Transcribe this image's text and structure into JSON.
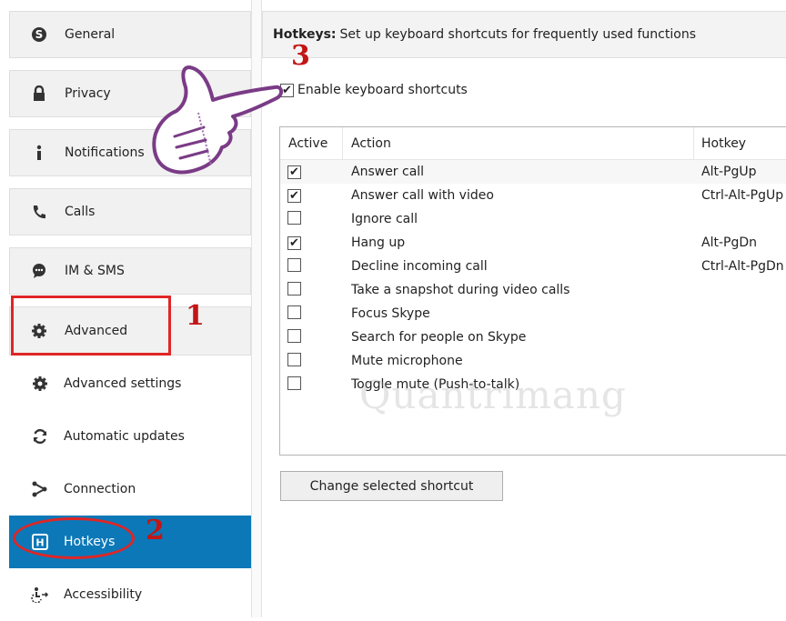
{
  "sidebar": {
    "categories": [
      {
        "label": "General",
        "icon": "skype-icon"
      },
      {
        "label": "Privacy",
        "icon": "lock-icon"
      },
      {
        "label": "Notifications",
        "icon": "info-icon"
      },
      {
        "label": "Calls",
        "icon": "phone-icon"
      },
      {
        "label": "IM & SMS",
        "icon": "chat-icon"
      },
      {
        "label": "Advanced",
        "icon": "gear-icon"
      }
    ],
    "subitems": [
      {
        "label": "Advanced settings",
        "icon": "gear-icon"
      },
      {
        "label": "Automatic updates",
        "icon": "refresh-icon"
      },
      {
        "label": "Connection",
        "icon": "connection-icon"
      },
      {
        "label": "Hotkeys",
        "icon": "hotkeys-icon",
        "active": true
      },
      {
        "label": "Accessibility",
        "icon": "accessibility-icon"
      }
    ]
  },
  "header": {
    "title": "Hotkeys:",
    "description": "Set up keyboard shortcuts for frequently used functions"
  },
  "enable": {
    "label": "Enable keyboard shortcuts",
    "checked": true
  },
  "table": {
    "columns": [
      "Active",
      "Action",
      "Hotkey"
    ],
    "rows": [
      {
        "active": true,
        "action": "Answer call",
        "hotkey": "Alt-PgUp"
      },
      {
        "active": true,
        "action": "Answer call with video",
        "hotkey": "Ctrl-Alt-PgUp"
      },
      {
        "active": false,
        "action": "Ignore call",
        "hotkey": ""
      },
      {
        "active": true,
        "action": "Hang up",
        "hotkey": "Alt-PgDn"
      },
      {
        "active": false,
        "action": "Decline incoming call",
        "hotkey": "Ctrl-Alt-PgDn"
      },
      {
        "active": false,
        "action": "Take a snapshot during video calls",
        "hotkey": ""
      },
      {
        "active": false,
        "action": "Focus Skype",
        "hotkey": ""
      },
      {
        "active": false,
        "action": "Search for people on Skype",
        "hotkey": ""
      },
      {
        "active": false,
        "action": "Mute microphone",
        "hotkey": ""
      },
      {
        "active": false,
        "action": "Toggle mute (Push-to-talk)",
        "hotkey": ""
      }
    ]
  },
  "buttons": {
    "change_shortcut": "Change selected shortcut"
  },
  "annotations": {
    "step1": "1",
    "step2": "2",
    "step3": "3",
    "color": "#e02525"
  },
  "watermark": "Quantrimang",
  "colors": {
    "accent": "#0c78b8"
  }
}
